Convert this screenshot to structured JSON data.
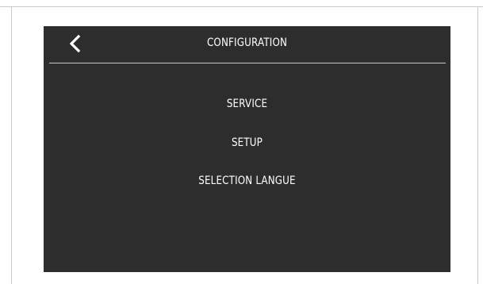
{
  "header": {
    "title": "CONFIGURATION",
    "back_icon": "chevron-left-icon"
  },
  "menu": {
    "items": [
      {
        "label": "SERVICE"
      },
      {
        "label": "SETUP"
      },
      {
        "label": "SELECTION LANGUE"
      }
    ]
  },
  "colors": {
    "screen_background": "#2d2d2d",
    "text": "#ffffff",
    "divider": "#c8c8c8",
    "frame_line": "#c9c9c9"
  }
}
